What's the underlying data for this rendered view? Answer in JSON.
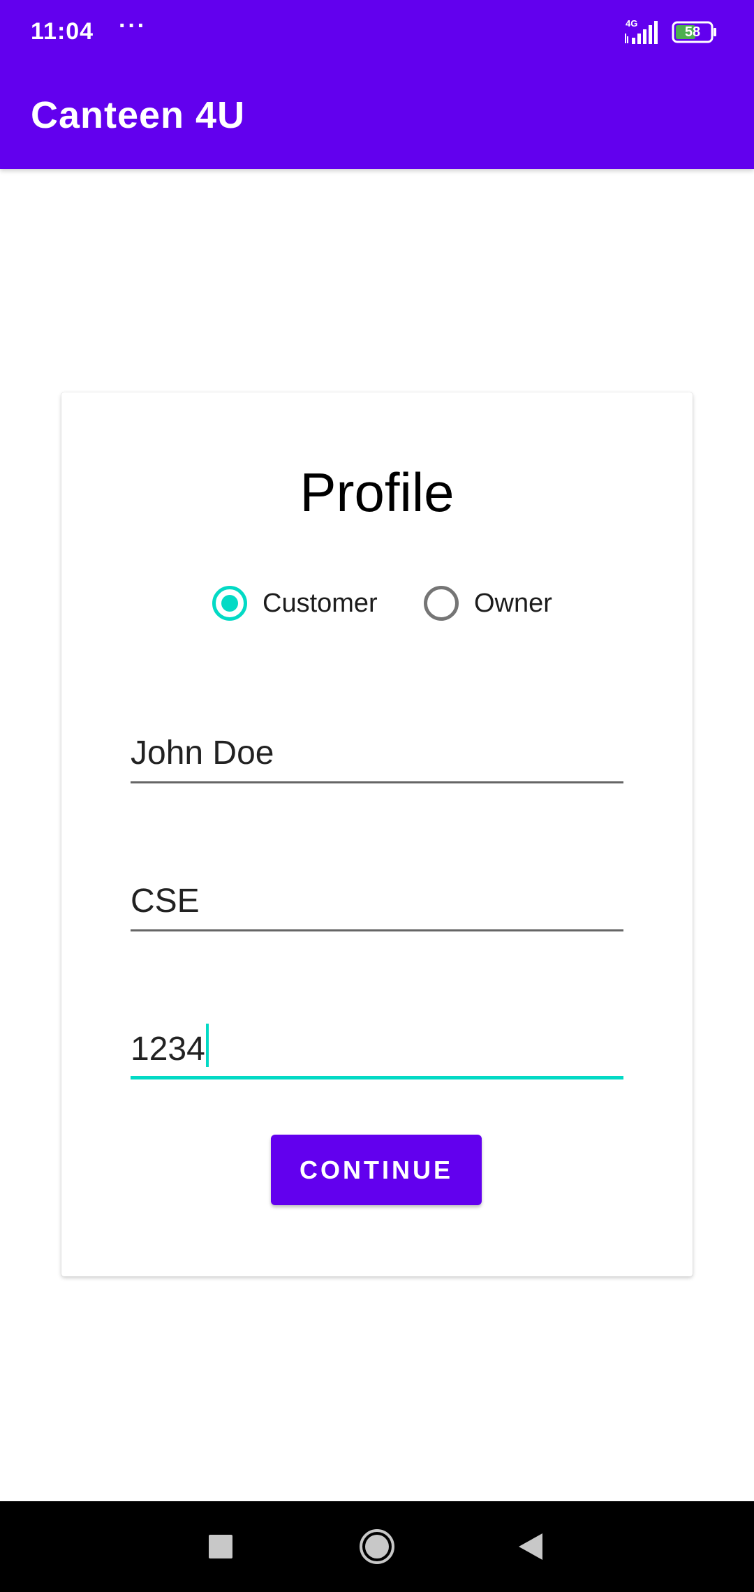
{
  "status_bar": {
    "time": "11:04",
    "dots": "···",
    "network": "4G",
    "battery": "58"
  },
  "app_bar": {
    "title": "Canteen 4U"
  },
  "profile": {
    "title": "Profile",
    "roles": [
      {
        "label": "Customer",
        "selected": true
      },
      {
        "label": "Owner",
        "selected": false
      }
    ],
    "fields": {
      "name": "John Doe",
      "department": "CSE",
      "id": "1234"
    },
    "continue_label": "CONTINUE"
  },
  "colors": {
    "primary": "#6200EE",
    "accent": "#03DAC5",
    "navbar": "#000000"
  },
  "navigation": {
    "icons": [
      "recent-apps-icon",
      "home-icon",
      "back-icon"
    ]
  }
}
